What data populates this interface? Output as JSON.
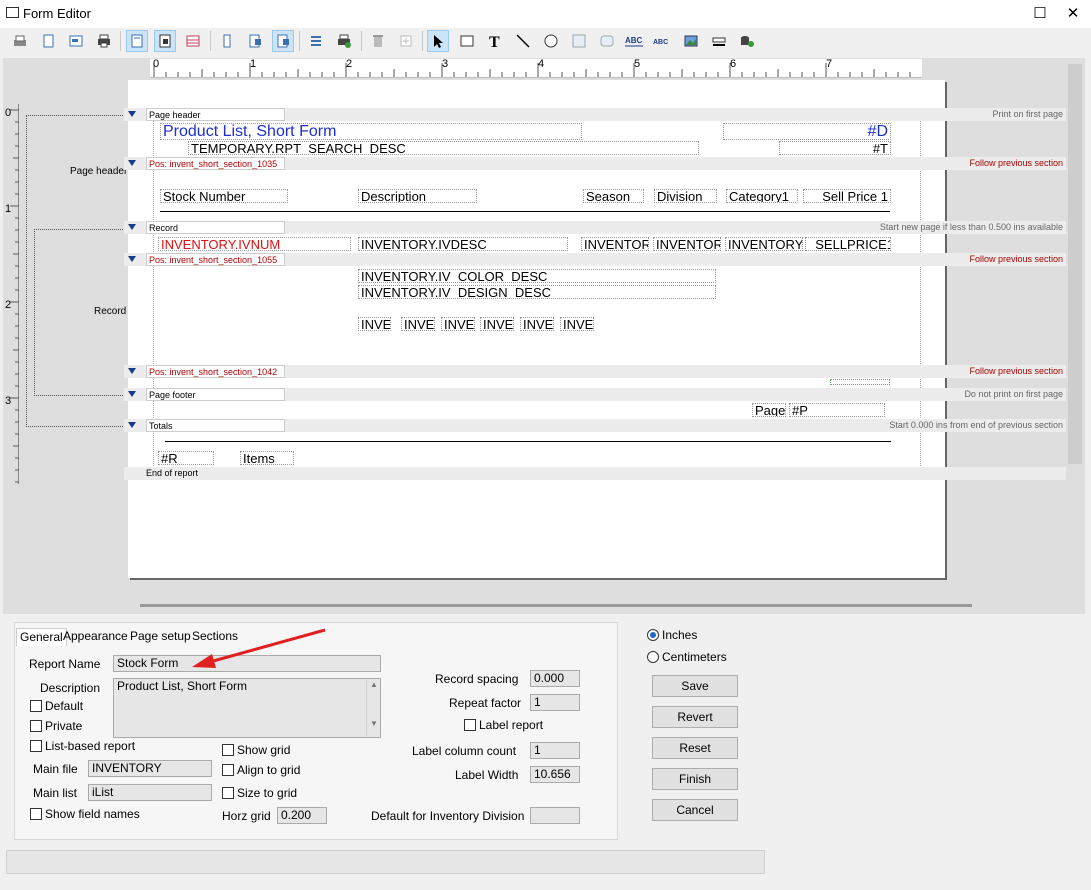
{
  "window": {
    "title": "Form Editor"
  },
  "ruler": {
    "top": [
      "0",
      "1",
      "2",
      "3",
      "4",
      "5",
      "6",
      "7"
    ],
    "left": [
      "0",
      "1",
      "2",
      "3"
    ]
  },
  "bands": {
    "page_header": {
      "label": "Page header",
      "right": "Print on first page",
      "side": "Page header"
    },
    "pos1035": {
      "label": "Pos: invent_short_section_1035",
      "right": "Follow previous section"
    },
    "record": {
      "label": "Record",
      "right": "Start new page if less than 0.500 ins available",
      "side": "Record"
    },
    "pos1055": {
      "label": "Pos: invent_short_section_1055",
      "right": "Follow previous section"
    },
    "pos1042": {
      "label": "Pos: invent_short_section_1042",
      "right": "Follow previous section"
    },
    "page_footer": {
      "label": "Page footer",
      "right": "Do not print on first page"
    },
    "totals": {
      "label": "Totals",
      "right": "Start 0.000 ins from end of previous section"
    },
    "end": {
      "label": "End of report"
    }
  },
  "fields": {
    "title": "Product List, Short Form",
    "date": "#D",
    "search": "TEMPORARY.RPT_SEARCH_DESC",
    "time": "#T",
    "col_stock": "Stock Number",
    "col_desc": "Description",
    "col_season": "Season",
    "col_division": "Division",
    "col_category": "Category1",
    "col_sell": "Sell Price 1",
    "rec_ivnum": "INVENTORY.IVNUM",
    "rec_ivdesc": "INVENTORY.IVDESC",
    "rec_inv1": "INVENTOR",
    "rec_inv2": "INVENTOR",
    "rec_inv3": "INVENTORY.",
    "rec_sell": "_SELLPRICE1",
    "color_desc": "INVENTORY.IV_COLOR_DESC",
    "design_desc": "INVENTORY.IV_DESIGN_DESC",
    "inve": [
      "INVE",
      "INVE",
      "INVE",
      "INVE",
      "INVE",
      "INVE"
    ],
    "page_label": "Page",
    "page_num": "#P",
    "total_r": "#R",
    "total_items": "Items"
  },
  "tabs": [
    "General",
    "Appearance",
    "Page setup",
    "Sections"
  ],
  "general": {
    "report_name_label": "Report Name",
    "report_name": "Stock Form",
    "description_label": "Description",
    "description": "Product List, Short Form",
    "default": "Default",
    "private": "Private",
    "list_based": "List-based report",
    "show_grid": "Show grid",
    "align_grid": "Align to grid",
    "size_grid": "Size to grid",
    "main_file_label": "Main file",
    "main_file": "INVENTORY",
    "main_list_label": "Main list",
    "main_list": "iList",
    "show_field_names": "Show field names",
    "horz_grid_label": "Horz grid",
    "horz_grid": "0.200",
    "record_spacing_label": "Record spacing",
    "record_spacing": "0.000",
    "repeat_factor_label": "Repeat factor",
    "repeat_factor": "1",
    "label_report": "Label report",
    "label_col_label": "Label column count",
    "label_col": "1",
    "label_width_label": "Label Width",
    "label_width": "10.656",
    "default_div_label": "Default for Inventory Division",
    "default_div": ""
  },
  "units": {
    "inches": "Inches",
    "cm": "Centimeters",
    "selected": "Inches"
  },
  "buttons": {
    "save": "Save",
    "revert": "Revert",
    "reset": "Reset",
    "finish": "Finish",
    "cancel": "Cancel"
  },
  "colors": {
    "arrow": "#e02020",
    "field_blue": "#1f2fd0",
    "field_red": "#d11111",
    "band_red": "#b00000"
  }
}
